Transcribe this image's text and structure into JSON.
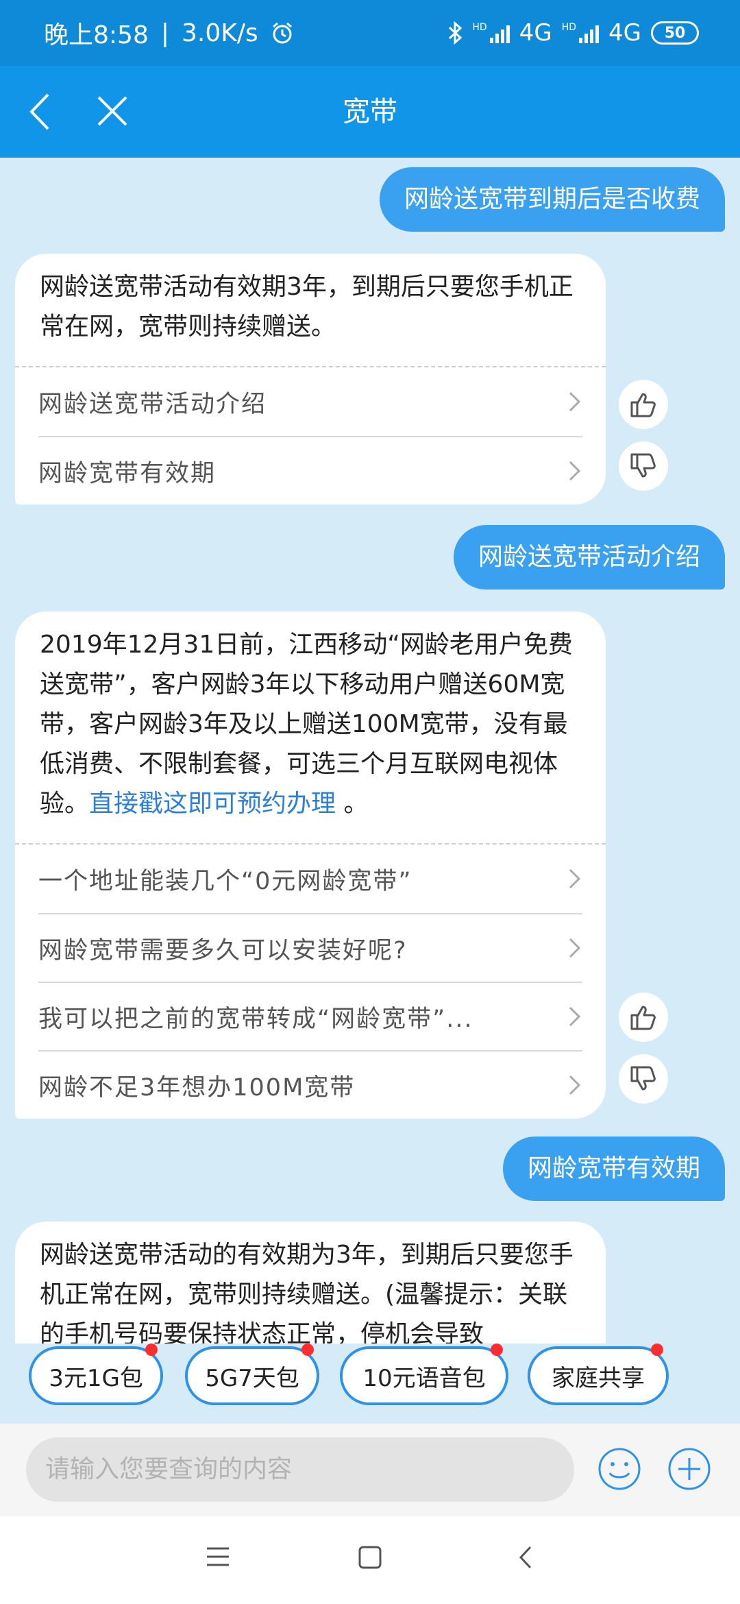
{
  "status_bar": {
    "time": "晚上8:58",
    "separator": "|",
    "speed": "3.0K/s",
    "net1": "4G",
    "net2": "4G",
    "hd1": "HD",
    "hd2": "HD",
    "battery": "50"
  },
  "header": {
    "title": "宽带"
  },
  "messages": {
    "q1": "网龄送宽带到期后是否收费",
    "a1": {
      "text": "网龄送宽带活动有效期3年，到期后只要您手机正常在网，宽带则持续赠送。",
      "items": [
        "网龄送宽带活动介绍",
        "网龄宽带有效期"
      ]
    },
    "q2": "网龄送宽带活动介绍",
    "a2": {
      "text": "2019年12月31日前，江西移动“网龄老用户免费送宽带”，客户网龄3年以下移动用户赠送60M宽带，客户网龄3年及以上赠送100M宽带，没有最低消费、不限制套餐，可选三个月互联网电视体验。",
      "link": "直接戳这即可预约办理",
      "after_link": " 。",
      "items": [
        "一个地址能装几个“0元网龄宽带”",
        "网龄宽带需要多久可以安装好呢?",
        "我可以把之前的宽带转成“网龄宽带”...",
        "网龄不足3年想办100M宽带"
      ]
    },
    "q3": "网龄宽带有效期",
    "a3": {
      "text": "网龄送宽带活动的有效期为3年，到期后只要您手机正常在网，宽带则持续赠送。(温馨提示：关联的手机号码要保持状态正常，停机会导致"
    }
  },
  "quick_chips": [
    "3元1G包",
    "5G7天包",
    "10元语音包",
    "家庭共享"
  ],
  "input": {
    "placeholder": "请输入您要查询的内容"
  },
  "icons": {
    "accent": "#1195e8",
    "status_bg": "#0e8ad9",
    "bubble": "#3aa0f0",
    "chat_bg": "#d6ebf8"
  }
}
